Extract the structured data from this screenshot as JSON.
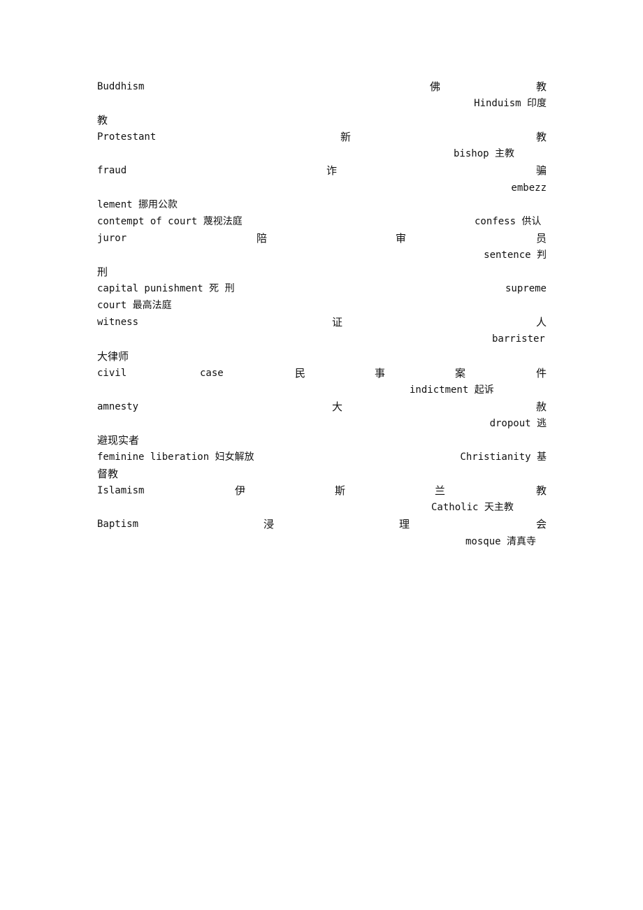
{
  "document": {
    "lines": [
      [
        "Buddhism",
        "佛",
        "教"
      ],
      [
        "Hinduism 印度"
      ],
      [
        "教"
      ],
      [
        "Protestant",
        "新",
        "教"
      ],
      [
        "bishop 主教"
      ],
      [
        "fraud",
        "诈",
        "骗"
      ],
      [
        "embezz"
      ],
      [
        "lement 挪用公款"
      ],
      [
        "contempt of court 蔑视法庭",
        "confess 供认"
      ],
      [
        "juror",
        "陪",
        "审",
        "员"
      ],
      [
        "sentence 判"
      ],
      [
        "刑"
      ],
      [
        "capital  punishment 死 刑",
        "supreme"
      ],
      [
        "court 最高法庭"
      ],
      [
        "witness",
        "证",
        "人"
      ],
      [
        "barrister"
      ],
      [
        "大律师"
      ],
      [
        "civil",
        "case",
        "民",
        "事",
        "案",
        "件"
      ],
      [
        "indictment 起诉"
      ],
      [
        "amnesty",
        "大",
        "赦"
      ],
      [
        "dropout 逃"
      ],
      [
        "避现实者"
      ],
      [
        "feminine liberation 妇女解放",
        "Christianity 基"
      ],
      [
        "督教"
      ],
      [
        "Islamism",
        "伊",
        "斯",
        "兰",
        "教"
      ],
      [
        "Catholic 天主教"
      ],
      [
        "Baptism",
        "浸",
        "理",
        "会"
      ],
      [
        "mosque 清真寺"
      ]
    ]
  }
}
